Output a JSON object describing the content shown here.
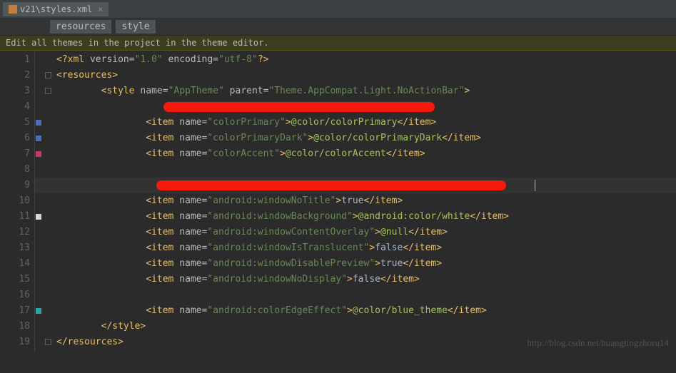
{
  "tab": {
    "label": "v21\\styles.xml"
  },
  "breadcrumbs": {
    "a": "resources",
    "b": "style"
  },
  "hint": "Edit all themes in the project in the theme editor.",
  "line_count": 19,
  "gutter_marks": {
    "5": "#4a6db5",
    "6": "#4a6db5",
    "7": "#c93a6a",
    "11": "#d8d8d8",
    "17": "#2aa4a4"
  },
  "code": {
    "l1": {
      "pi_open": "<?",
      "pi_name": "xml",
      "attr1": " version=",
      "str1": "\"1.0\"",
      "attr2": " encoding=",
      "str2": "\"utf-8\"",
      "pi_close": "?>"
    },
    "l2": {
      "open": "<resources>",
      "indent": ""
    },
    "l3": {
      "indent": "        ",
      "tag_open": "<style ",
      "attr1": "name=",
      "str1": "\"AppTheme\"",
      "sp": " ",
      "attr2": "parent=",
      "str2": "\"Theme.AppCompat.Light.NoActionBar\"",
      "tag_end": ">"
    },
    "l5": {
      "indent": "                ",
      "tag_open": "<item ",
      "attr": "name=",
      "str": "\"colorPrimary\"",
      "gt": ">",
      "val": "@color/colorPrimary",
      "close": "</item>"
    },
    "l6": {
      "indent": "                ",
      "tag_open": "<item ",
      "attr": "name=",
      "str": "\"colorPrimaryDark\"",
      "gt": ">",
      "val": "@color/colorPrimaryDark",
      "close": "</item>"
    },
    "l7": {
      "indent": "                ",
      "tag_open": "<item ",
      "attr": "name=",
      "str": "\"colorAccent\"",
      "gt": ">",
      "val": "@color/colorAccent",
      "close": "</item>"
    },
    "l10": {
      "indent": "                ",
      "tag_open": "<item ",
      "attr": "name=",
      "str": "\"android:windowNoTitle\"",
      "gt": ">",
      "val": "true",
      "close": "</item>"
    },
    "l11": {
      "indent": "                ",
      "tag_open": "<item ",
      "attr": "name=",
      "str": "\"android:windowBackground\"",
      "gt": ">",
      "val": "@android:color/white",
      "close": "</item>"
    },
    "l12": {
      "indent": "                ",
      "tag_open": "<item ",
      "attr": "name=",
      "str": "\"android:windowContentOverlay\"",
      "gt": ">",
      "val": "@null",
      "close": "</item>"
    },
    "l13": {
      "indent": "                ",
      "tag_open": "<item ",
      "attr": "name=",
      "str": "\"android:windowIsTranslucent\"",
      "gt": ">",
      "val": "false",
      "close": "</item>"
    },
    "l14": {
      "indent": "                ",
      "tag_open": "<item ",
      "attr": "name=",
      "str": "\"android:windowDisablePreview\"",
      "gt": ">",
      "val": "true",
      "close": "</item>"
    },
    "l15": {
      "indent": "                ",
      "tag_open": "<item ",
      "attr": "name=",
      "str": "\"android:windowNoDisplay\"",
      "gt": ">",
      "val": "false",
      "close": "</item>"
    },
    "l17": {
      "indent": "                ",
      "tag_open": "<item ",
      "attr": "name=",
      "str": "\"android:colorEdgeEffect\"",
      "gt": ">",
      "val": "@color/blue_theme",
      "close": "</item>"
    },
    "l18": {
      "indent": "        ",
      "close": "</style>"
    },
    "l19": {
      "close": "</resources>"
    }
  },
  "watermark": "http://blog.csdn.net/huangtingzhoru14"
}
